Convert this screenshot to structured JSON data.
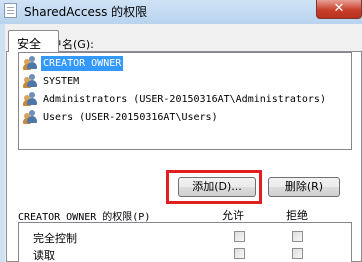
{
  "window": {
    "title": "SharedAccess 的权限",
    "close_label": "✕"
  },
  "tab": {
    "label": "安全"
  },
  "groups": {
    "label": "组或用户名(G):",
    "items": [
      {
        "name": "CREATOR OWNER",
        "selected": true
      },
      {
        "name": "SYSTEM",
        "selected": false
      },
      {
        "name": "Administrators (USER-20150316AT\\Administrators)",
        "selected": false
      },
      {
        "name": "Users (USER-20150316AT\\Users)",
        "selected": false
      }
    ]
  },
  "buttons": {
    "add_label": "添加(D)...",
    "remove_label": "删除(R)"
  },
  "permissions": {
    "label": "CREATOR OWNER 的权限(P)",
    "allow_header": "允许",
    "deny_header": "拒绝",
    "rows": [
      {
        "name": "完全控制",
        "allow": false,
        "deny": false
      },
      {
        "name": "读取",
        "allow": false,
        "deny": false
      }
    ]
  },
  "colors": {
    "selection": "#3399ff",
    "highlight_border": "#e02020",
    "close_button": "#c8402c"
  }
}
